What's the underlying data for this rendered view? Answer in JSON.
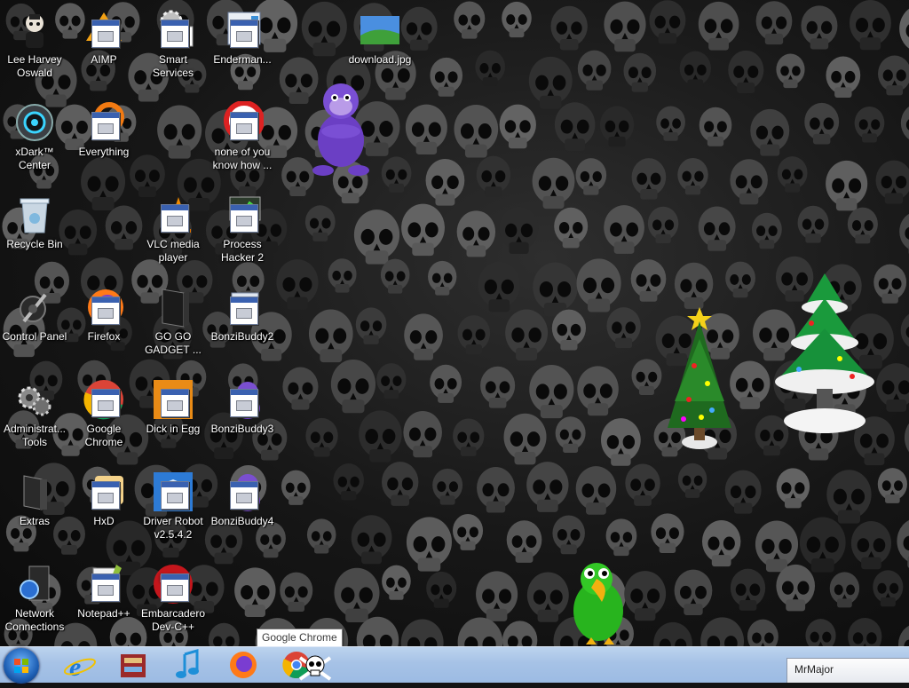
{
  "desktop_icons": [
    {
      "label": "Lee Harvey Oswald",
      "icon": "doll-icon"
    },
    {
      "label": "AIMP",
      "icon": "aimp-icon"
    },
    {
      "label": "Smart Services",
      "icon": "gears-icon"
    },
    {
      "label": "Enderman...",
      "icon": "window-icon"
    },
    {
      "label": "download.jpg",
      "icon": "image-file-icon"
    },
    {
      "label": "xDark™ Center",
      "icon": "speaker-orb-icon"
    },
    {
      "label": "Everything",
      "icon": "search-ring-icon"
    },
    {
      "label": "none of you know how ...",
      "icon": "circle-app-icon"
    },
    {
      "label": "Recycle Bin",
      "icon": "recycle-bin-icon"
    },
    {
      "label": "VLC media player",
      "icon": "vlc-cone-icon"
    },
    {
      "label": "Process Hacker 2",
      "icon": "monitor-icon"
    },
    {
      "label": "Control Panel",
      "icon": "control-panel-icon"
    },
    {
      "label": "Firefox",
      "icon": "firefox-icon"
    },
    {
      "label": "GO GO GADGET ...",
      "icon": "black-box-icon"
    },
    {
      "label": "BonziBuddy2",
      "icon": "window-icon"
    },
    {
      "label": "Administrat... Tools",
      "icon": "admin-gears-icon"
    },
    {
      "label": "Google Chrome",
      "icon": "chrome-icon"
    },
    {
      "label": "Dick in Egg",
      "icon": "egg-app-icon"
    },
    {
      "label": "BonziBuddy3",
      "icon": "bonzi-icon"
    },
    {
      "label": "Extras",
      "icon": "folder-black-icon"
    },
    {
      "label": "HxD",
      "icon": "hxd-icon"
    },
    {
      "label": "Driver Robot v2.5.4.2",
      "icon": "shield-app-icon"
    },
    {
      "label": "BonziBuddy4",
      "icon": "bonzi-icon"
    },
    {
      "label": "Network Connections",
      "icon": "network-icon"
    },
    {
      "label": "Notepad++",
      "icon": "notepad-icon"
    },
    {
      "label": "Embarcadero Dev-C++",
      "icon": "devcpp-icon"
    }
  ],
  "taskbar": {
    "buttons": [
      {
        "name": "internet-explorer",
        "icon": "ie-icon"
      },
      {
        "name": "archive-app",
        "icon": "archive-icon"
      },
      {
        "name": "music-app",
        "icon": "music-note-icon"
      },
      {
        "name": "firefox",
        "icon": "firefox-icon"
      },
      {
        "name": "google-chrome",
        "icon": "chrome-icon"
      }
    ],
    "tooltip": "Google Chrome",
    "notification_title": "MrMajor"
  },
  "colors": {
    "taskbar": "#a6c2e6",
    "tooltip_bg": "#ffffff",
    "label_text": "#ffffff"
  }
}
